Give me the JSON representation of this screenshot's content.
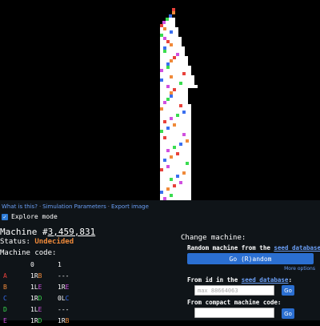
{
  "links": {
    "what_is_this": "What is this?",
    "simulation_parameters": "Simulation Parameters",
    "export_image": "Export image",
    "separator": "·"
  },
  "explore_mode": {
    "label": "Explore mode",
    "checked": true
  },
  "machine": {
    "prefix": "Machine #",
    "id": "3,459,831",
    "status_label": "Status:",
    "status_value": "Undecided",
    "code_label": "Machine code:"
  },
  "code_table": {
    "headers": [
      "",
      "0",
      "1"
    ],
    "rows": [
      {
        "state": "A",
        "state_color": "#e8413b",
        "c0": {
          "prefix": "1R",
          "target": "B",
          "color": "#f08a3a"
        },
        "c1": {
          "prefix": "---",
          "target": "",
          "color": "#fff"
        }
      },
      {
        "state": "B",
        "state_color": "#f08a3a",
        "c0": {
          "prefix": "1L",
          "target": "E",
          "color": "#d050e0"
        },
        "c1": {
          "prefix": "1R",
          "target": "E",
          "color": "#d050e0"
        }
      },
      {
        "state": "C",
        "state_color": "#3a6ff0",
        "c0": {
          "prefix": "1R",
          "target": "D",
          "color": "#3adc50"
        },
        "c1": {
          "prefix": "0L",
          "target": "C",
          "color": "#3a6ff0"
        }
      },
      {
        "state": "D",
        "state_color": "#3adc50",
        "c0": {
          "prefix": "1L",
          "target": "E",
          "color": "#d050e0"
        },
        "c1": {
          "prefix": "---",
          "target": "",
          "color": "#fff"
        }
      },
      {
        "state": "E",
        "state_color": "#d050e0",
        "c0": {
          "prefix": "1R",
          "target": "D",
          "color": "#3adc50"
        },
        "c1": {
          "prefix": "1R",
          "target": "B",
          "color": "#f08a3a"
        }
      }
    ]
  },
  "change_machine": {
    "title": "Change machine:",
    "random_label_prefix": "Random machine from the",
    "seed_database": "seed database",
    "random_label_suffix": ":",
    "go_random": "Go (R)andom",
    "more_options": "More options",
    "from_id_prefix": "From id in the",
    "from_id_suffix": ":",
    "id_placeholder": "max 88664063",
    "go": "Go",
    "compact_label": "From compact machine code:",
    "compact_value": ""
  },
  "colors": {
    "accent": "#2b6fd1",
    "link": "#6a9ef5",
    "status": "#f08a3a",
    "panel_bg": "#0f1418"
  }
}
